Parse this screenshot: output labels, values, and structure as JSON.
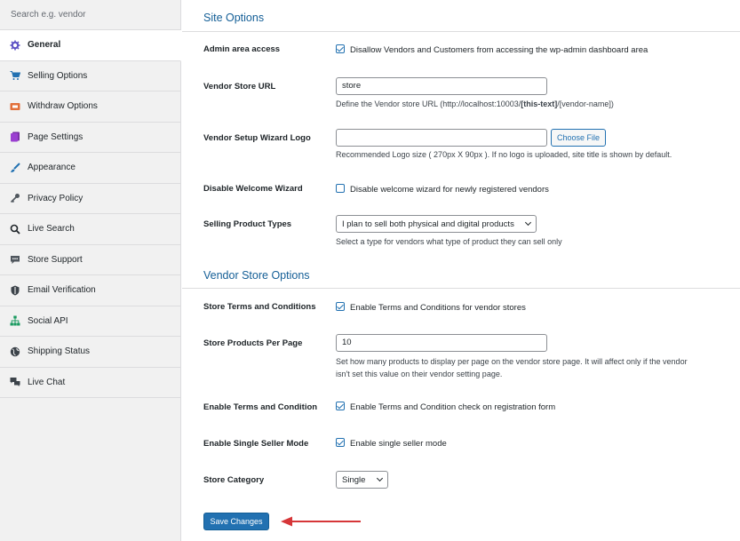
{
  "sidebar": {
    "search_placeholder": "Search e.g. vendor",
    "items": [
      {
        "label": "General",
        "icon": "gear-icon",
        "active": true
      },
      {
        "label": "Selling Options",
        "icon": "cart-icon"
      },
      {
        "label": "Withdraw Options",
        "icon": "withdraw-icon"
      },
      {
        "label": "Page Settings",
        "icon": "page-icon"
      },
      {
        "label": "Appearance",
        "icon": "brush-icon"
      },
      {
        "label": "Privacy Policy",
        "icon": "key-icon"
      },
      {
        "label": "Live Search",
        "icon": "search-icon"
      },
      {
        "label": "Store Support",
        "icon": "chat-icon"
      },
      {
        "label": "Email Verification",
        "icon": "shield-icon"
      },
      {
        "label": "Social API",
        "icon": "network-icon"
      },
      {
        "label": "Shipping Status",
        "icon": "globe-icon"
      },
      {
        "label": "Live Chat",
        "icon": "chat-bubbles-icon"
      }
    ]
  },
  "site_options": {
    "title": "Site Options",
    "admin_access": {
      "label": "Admin area access",
      "checkbox_label": "Disallow Vendors and Customers from accessing the wp-admin dashboard area",
      "checked": true
    },
    "store_url": {
      "label": "Vendor Store URL",
      "value": "store",
      "desc_prefix": "Define the Vendor store URL (http://localhost:10003/",
      "desc_bold": "[this-text]",
      "desc_suffix": "/[vendor-name])"
    },
    "wizard_logo": {
      "label": "Vendor Setup Wizard Logo",
      "value": "",
      "button": "Choose File",
      "desc": "Recommended Logo size ( 270px X 90px ). If no logo is uploaded, site title is shown by default."
    },
    "disable_wizard": {
      "label": "Disable Welcome Wizard",
      "checkbox_label": "Disable welcome wizard for newly registered vendors",
      "checked": false
    },
    "product_types": {
      "label": "Selling Product Types",
      "selected": "I plan to sell both physical and digital products",
      "desc": "Select a type for vendors what type of product they can sell only"
    }
  },
  "vendor_store_options": {
    "title": "Vendor Store Options",
    "terms": {
      "label": "Store Terms and Conditions",
      "checkbox_label": "Enable Terms and Conditions for vendor stores",
      "checked": true
    },
    "per_page": {
      "label": "Store Products Per Page",
      "value": "10",
      "desc_line1": "Set how many products to display per page on the vendor store page. It will affect only if the vendor",
      "desc_line2": "isn't set this value on their vendor setting page."
    },
    "enable_terms": {
      "label": "Enable Terms and Condition",
      "checkbox_label": "Enable Terms and Condition check on registration form",
      "checked": true
    },
    "single_seller": {
      "label": "Enable Single Seller Mode",
      "checkbox_label": "Enable single seller mode",
      "checked": true
    },
    "category": {
      "label": "Store Category",
      "selected": "Single"
    }
  },
  "save_button": "Save Changes",
  "colors": {
    "accent": "#2271b1",
    "title": "#135e96",
    "arrow": "#d63638"
  }
}
